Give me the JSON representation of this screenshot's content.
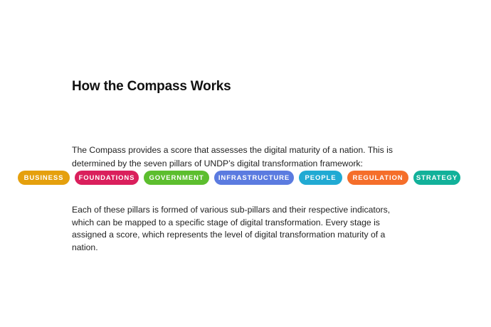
{
  "section": {
    "title": "How the Compass Works",
    "intro": "The Compass provides a score that assesses the digital maturity of a nation. This is determined by the seven pillars of UNDP’s digital transformation framework:",
    "body": "Each of these pillars is formed of various sub-pillars and their respective indicators, which can be mapped to a specific stage of digital transformation. Every stage is assigned a score, which represents the level of digital transformation maturity of a nation."
  },
  "pillars": [
    {
      "label": "BUSINESS",
      "color": "#E5A00D"
    },
    {
      "label": "FOUNDATIONS",
      "color": "#DA1F5C"
    },
    {
      "label": "GOVERNMENT",
      "color": "#5CBE2E"
    },
    {
      "label": "INFRASTRUCTURE",
      "color": "#5B7BE0"
    },
    {
      "label": "PEOPLE",
      "color": "#21AAD3"
    },
    {
      "label": "REGULATION",
      "color": "#F56E2A"
    },
    {
      "label": "STRATEGY",
      "color": "#12B19A"
    }
  ]
}
